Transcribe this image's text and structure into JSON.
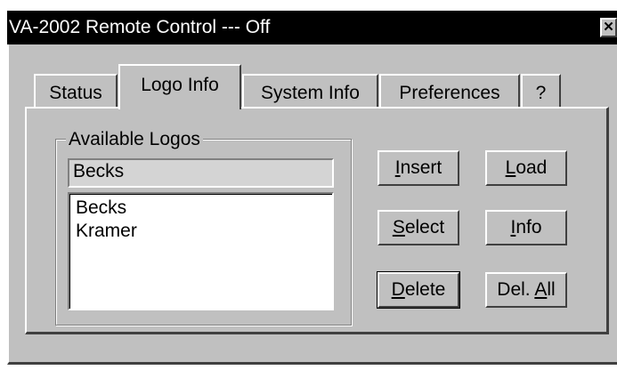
{
  "window": {
    "title": "VA-2002 Remote Control --- Off",
    "close_glyph": "✕"
  },
  "tabs": [
    {
      "label": "Status",
      "active": false
    },
    {
      "label": "Logo Info",
      "active": true
    },
    {
      "label": "System Info",
      "active": false
    },
    {
      "label": "Preferences",
      "active": false
    },
    {
      "label": "?",
      "active": false
    }
  ],
  "logos_group": {
    "label": "Available Logos",
    "selected_value": "Becks",
    "items": [
      "Becks",
      "Kramer"
    ]
  },
  "buttons": {
    "insert": {
      "pre": "",
      "key": "I",
      "post": "nsert"
    },
    "load": {
      "pre": "",
      "key": "L",
      "post": "oad"
    },
    "select": {
      "pre": "",
      "key": "S",
      "post": "elect"
    },
    "info": {
      "pre": "",
      "key": "I",
      "post": "nfo"
    },
    "delete": {
      "pre": "",
      "key": "D",
      "post": "elete"
    },
    "del_all": {
      "pre": "Del. ",
      "key": "A",
      "post": "ll"
    }
  },
  "icons": {
    "close": "close-icon"
  }
}
